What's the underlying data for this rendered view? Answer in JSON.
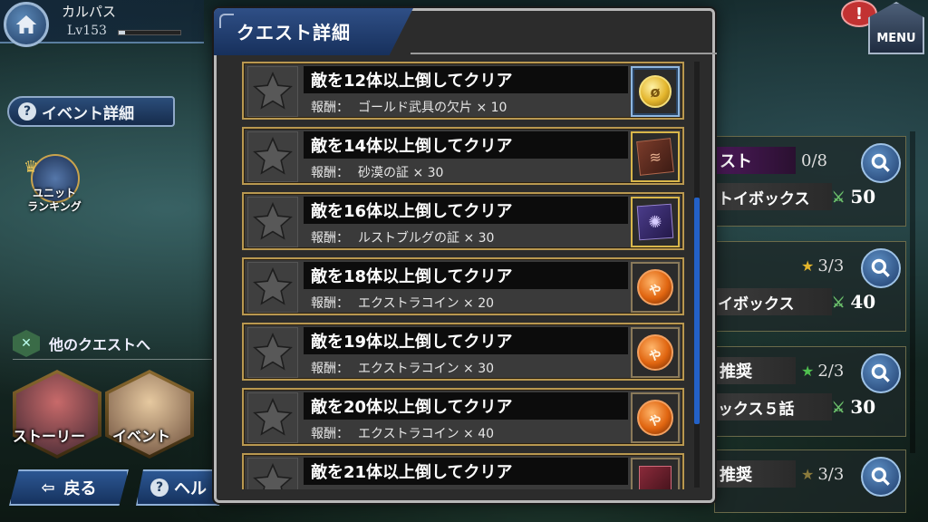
{
  "player": {
    "name": "カルパス",
    "level": "Lv153"
  },
  "left": {
    "event_detail_label": "イベント詳細",
    "ranking_label_line1": "ユニット",
    "ranking_label_line2": "ランキング",
    "other_quests_label": "他のクエストへ",
    "story_label": "ストーリー",
    "event_label": "イベント",
    "back_label": "戻る",
    "help_label": "ヘル"
  },
  "top_right": {
    "alert_mark": "!",
    "menu_label": "MENU"
  },
  "modal": {
    "title": "クエスト詳細",
    "reward_prefix": "報酬：",
    "quests": [
      {
        "name": "敵を12体以上倒してクリア",
        "reward": "ゴールド武具の欠片 × 10",
        "icon": "gold-coin-icon"
      },
      {
        "name": "敵を14体以上倒してクリア",
        "reward": "砂漠の証 × 30",
        "icon": "sand-scroll-icon"
      },
      {
        "name": "敵を16体以上倒してクリア",
        "reward": "ルストブルグの証 × 30",
        "icon": "purple-banner-icon"
      },
      {
        "name": "敵を18体以上倒してクリア",
        "reward": "エクストラコイン × 20",
        "icon": "extra-coin-icon"
      },
      {
        "name": "敵を19体以上倒してクリア",
        "reward": "エクストラコイン × 30",
        "icon": "extra-coin-icon"
      },
      {
        "name": "敵を20体以上倒してクリア",
        "reward": "エクストラコイン × 40",
        "icon": "extra-coin-icon"
      },
      {
        "name": "敵を21体以上倒してクリア",
        "reward": "",
        "icon": "red-box-icon"
      }
    ]
  },
  "right_list": [
    {
      "title": "スト",
      "progress": "0/8",
      "sub": "トイボックス",
      "reward": "50"
    },
    {
      "title": "",
      "progress": "3/3",
      "sub": "イボックス",
      "reward": "40"
    },
    {
      "title": "推奨",
      "progress": "2/3",
      "sub": "ックス５話",
      "reward": "30"
    },
    {
      "title": "推奨",
      "progress": "3/3",
      "sub": "",
      "reward": ""
    }
  ],
  "colors": {
    "accent_blue": "#2361c7",
    "gold_border": "#b99850",
    "modal_bg": "#2c2c2c",
    "progress_star_gold": "#e3b52c",
    "progress_star_green": "#4fbf4f",
    "progress_star_dark_gold": "#8a7a3c"
  }
}
